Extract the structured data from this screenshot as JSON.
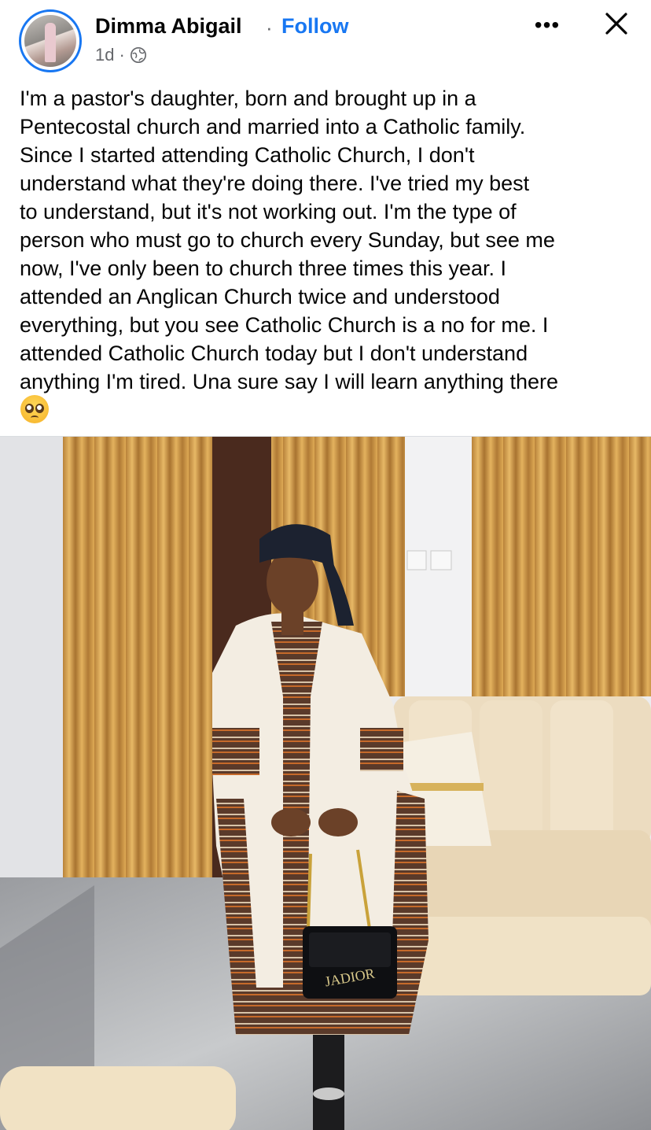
{
  "post": {
    "author_name": "Dimma Abigail",
    "separator": "·",
    "follow_label": "Follow",
    "time": "1d",
    "meta_separator": "·",
    "privacy_icon": "globe-icon",
    "more_icon": "more-options-icon",
    "more_label": "•••",
    "close_icon": "close-icon",
    "text": "I'm a pastor's daughter, born and brought up in a\nPentecostal church and married into a Catholic family.\nSince I started attending Catholic Church, I don't\nunderstand what they're doing there. I've tried my best\nto understand, but it's not working out. I'm the type of\nperson who must go to church every Sunday, but see me\nnow, I've only been to church three times this year. I\nattended an Anglican Church twice and understood\neverything, but you see Catholic Church is a no for me. I\nattended Catholic Church today but I don't understand\nanything I'm tired. Una sure say I will learn anything there",
    "emoji_icon": "pleading-face-emoji",
    "photo": {
      "bag_text": "JADIOR"
    }
  },
  "colors": {
    "accent": "#1877f2",
    "text": "#050505",
    "secondary_text": "#65676b"
  }
}
